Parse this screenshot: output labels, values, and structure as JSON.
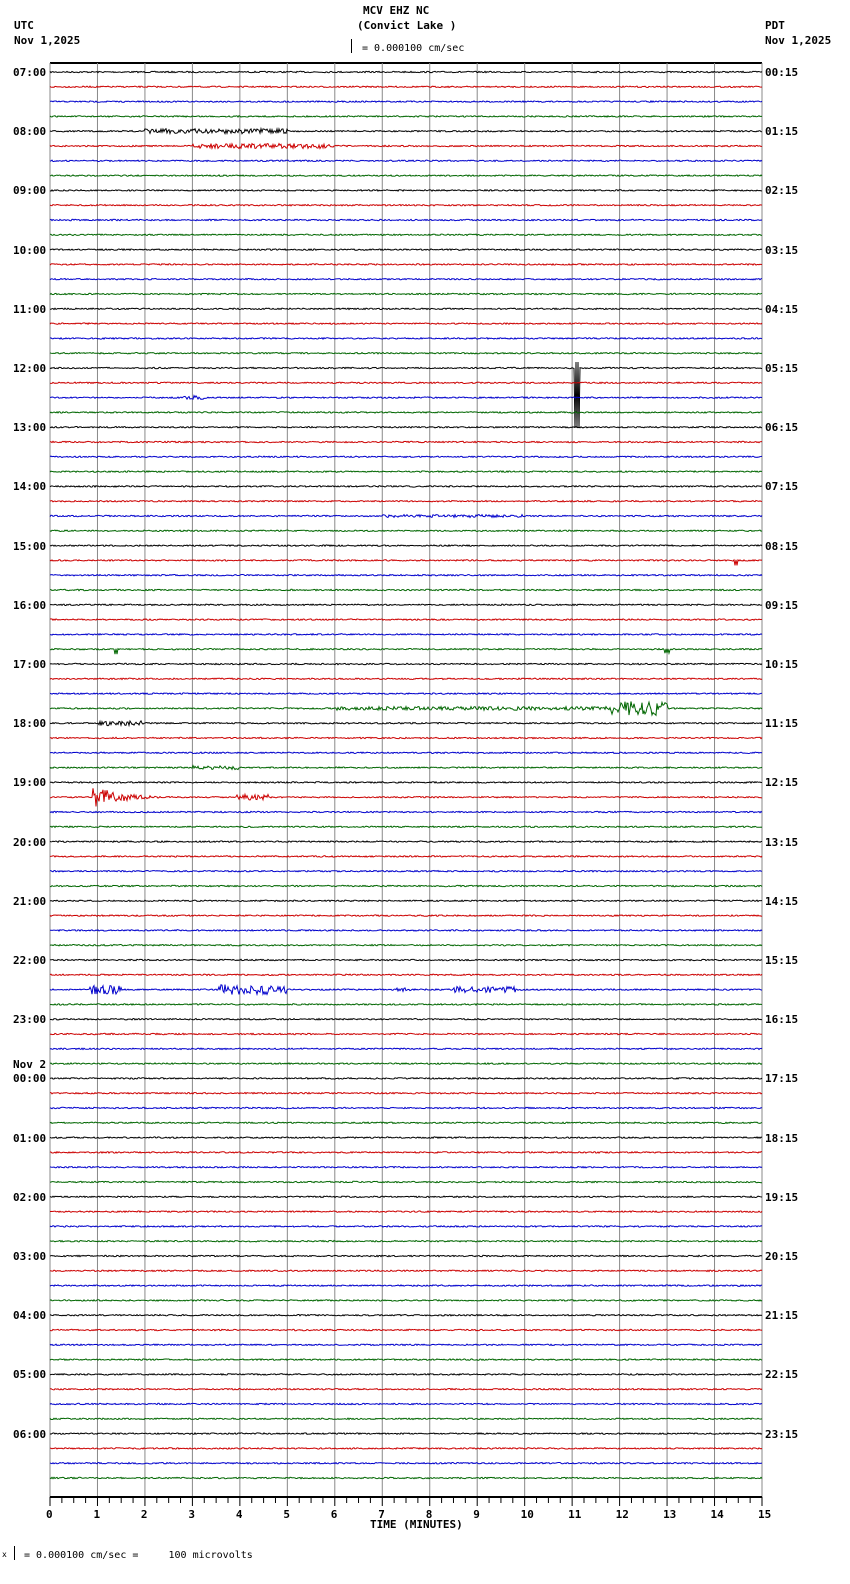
{
  "header": {
    "station": "MCV EHZ NC",
    "location": "(Convict Lake )",
    "scale": "= 0.000100 cm/sec",
    "left_tz": "UTC",
    "left_date": "Nov 1,2025",
    "right_tz": "PDT",
    "right_date": "Nov 1,2025"
  },
  "footer": {
    "scale_note": "= 0.000100 cm/sec =     100 microvolts",
    "mark": "x"
  },
  "chart_data": {
    "type": "line",
    "title": "MCV EHZ NC (Convict Lake )",
    "xlabel": "TIME (MINUTES)",
    "xlim": [
      0,
      15
    ],
    "xticks": [
      "0",
      "1",
      "2",
      "3",
      "4",
      "5",
      "6",
      "7",
      "8",
      "9",
      "10",
      "11",
      "12",
      "13",
      "14",
      "15"
    ],
    "traces_per_hour": 4,
    "trace_colors": [
      "#000000",
      "#cc0000",
      "#0000cc",
      "#006600"
    ],
    "left_labels": [
      "07:00",
      "08:00",
      "09:00",
      "10:00",
      "11:00",
      "12:00",
      "13:00",
      "14:00",
      "15:00",
      "16:00",
      "17:00",
      "18:00",
      "19:00",
      "20:00",
      "21:00",
      "22:00",
      "23:00",
      "00:00",
      "01:00",
      "02:00",
      "03:00",
      "04:00",
      "05:00",
      "06:00"
    ],
    "date_change": {
      "hour_index": 17,
      "label": "Nov 2"
    },
    "right_labels": [
      "00:15",
      "01:15",
      "02:15",
      "03:15",
      "04:15",
      "05:15",
      "06:15",
      "07:15",
      "08:15",
      "09:15",
      "10:15",
      "11:15",
      "12:15",
      "13:15",
      "14:15",
      "15:15",
      "16:15",
      "17:15",
      "18:15",
      "19:15",
      "20:15",
      "21:15",
      "22:15",
      "23:15"
    ],
    "events": [
      {
        "trace": 4,
        "start": 2,
        "end": 5,
        "amp": 2.5,
        "kind": "noise"
      },
      {
        "trace": 5,
        "start": 3,
        "end": 6,
        "amp": 2.5,
        "kind": "noise"
      },
      {
        "trace": 20,
        "start": 11.05,
        "end": 11.15,
        "amp": 60,
        "kind": "spike"
      },
      {
        "trace": 22,
        "start": 2.8,
        "end": 3.3,
        "amp": 2,
        "kind": "noise"
      },
      {
        "trace": 30,
        "start": 7,
        "end": 10,
        "amp": 1.5,
        "kind": "noise"
      },
      {
        "trace": 33,
        "start": 14.4,
        "end": 14.5,
        "amp": 5,
        "kind": "spike"
      },
      {
        "trace": 39,
        "start": 1.35,
        "end": 1.45,
        "amp": 5,
        "kind": "spike"
      },
      {
        "trace": 39,
        "start": 12.95,
        "end": 13.05,
        "amp": 4,
        "kind": "spike"
      },
      {
        "trace": 43,
        "start": 6,
        "end": 13,
        "amp": 1.8,
        "kind": "noise"
      },
      {
        "trace": 43,
        "start": 11.8,
        "end": 13,
        "amp": 7,
        "kind": "noise"
      },
      {
        "trace": 44,
        "start": 1,
        "end": 2,
        "amp": 2.5,
        "kind": "noise"
      },
      {
        "trace": 47,
        "start": 3,
        "end": 4,
        "amp": 2,
        "kind": "noise"
      },
      {
        "trace": 49,
        "start": 0.9,
        "end": 2.6,
        "amp": 12,
        "kind": "quake"
      },
      {
        "trace": 49,
        "start": 3.9,
        "end": 4.6,
        "amp": 3,
        "kind": "noise"
      },
      {
        "trace": 62,
        "start": 0.8,
        "end": 1.5,
        "amp": 5,
        "kind": "noise"
      },
      {
        "trace": 62,
        "start": 3.5,
        "end": 5,
        "amp": 5,
        "kind": "noise"
      },
      {
        "trace": 62,
        "start": 7.3,
        "end": 7.6,
        "amp": 2,
        "kind": "noise"
      },
      {
        "trace": 62,
        "start": 8.5,
        "end": 9.8,
        "amp": 3,
        "kind": "noise"
      }
    ]
  }
}
